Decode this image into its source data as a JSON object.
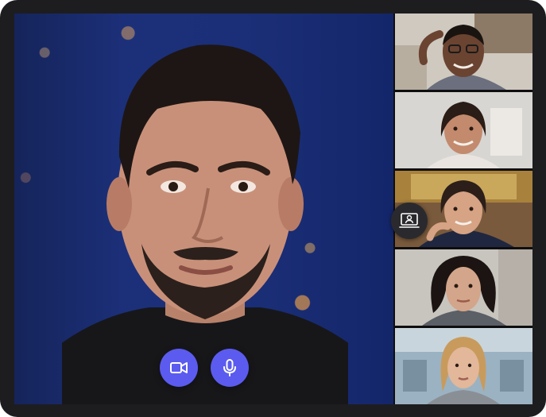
{
  "colors": {
    "frame": "#1d1d20",
    "accent": "#5b5bf0",
    "share_button": "#2a2a2e"
  },
  "main_video": {
    "icon": "speaker-video"
  },
  "controls": {
    "camera_icon": "video-camera-icon",
    "mic_icon": "microphone-icon"
  },
  "share_screen": {
    "icon": "screen-share-icon"
  },
  "participants": [
    {
      "icon": "participant-1-video"
    },
    {
      "icon": "participant-2-video"
    },
    {
      "icon": "participant-3-video"
    },
    {
      "icon": "participant-4-video"
    },
    {
      "icon": "participant-5-video"
    }
  ]
}
